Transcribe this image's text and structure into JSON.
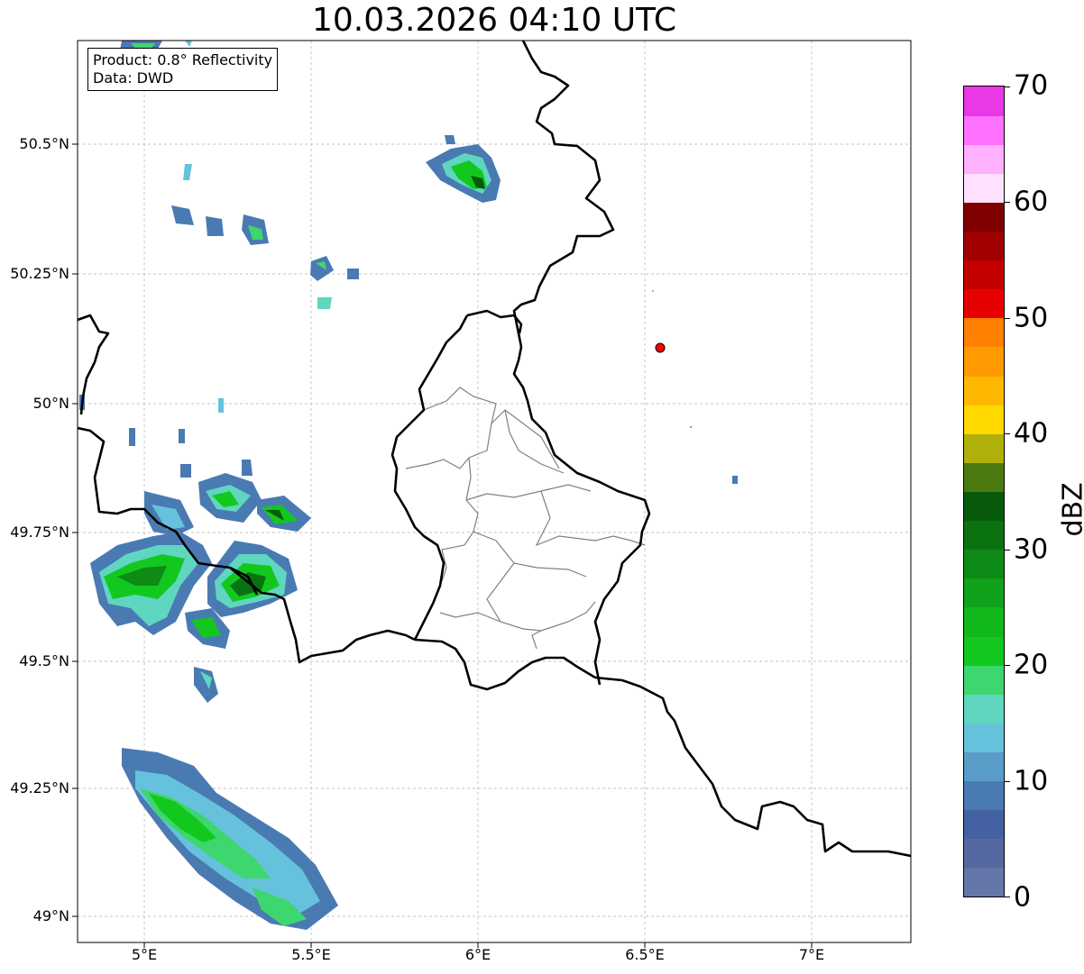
{
  "title": "10.03.2026 04:10 UTC",
  "info": {
    "product": "Product: 0.8° Reflectivity",
    "source": "Data: DWD"
  },
  "axes": {
    "lat_labels": [
      "50.5°N",
      "50.25°N",
      "50°N",
      "49.75°N",
      "49.5°N",
      "49.25°N",
      "49°N"
    ],
    "lon_labels": [
      "5°E",
      "5.5°E",
      "6°E",
      "6.5°E",
      "7°E"
    ]
  },
  "colorbar": {
    "unit": "dBZ",
    "tick_labels": [
      "0",
      "10",
      "20",
      "30",
      "40",
      "50",
      "60",
      "70"
    ],
    "colors": [
      "#6577a8",
      "#5569a0",
      "#4461a3",
      "#4a7ab2",
      "#5a9cc8",
      "#66c2dc",
      "#5fd6c0",
      "#3ed66e",
      "#12c81e",
      "#10b81c",
      "#0fa21a",
      "#0e8a16",
      "#0b7212",
      "#075a0c",
      "#4a7a10",
      "#b0b00a",
      "#ffd800",
      "#ffb800",
      "#ff9a00",
      "#ff7f00",
      "#e60000",
      "#c40000",
      "#a00000",
      "#800000",
      "#ffe0ff",
      "#ffb0ff",
      "#ff70ff",
      "#e838e8"
    ]
  },
  "map": {
    "marker_color": "#ff0000",
    "border_color": "#000000",
    "district_color": "#808080",
    "grid": "dashed"
  }
}
